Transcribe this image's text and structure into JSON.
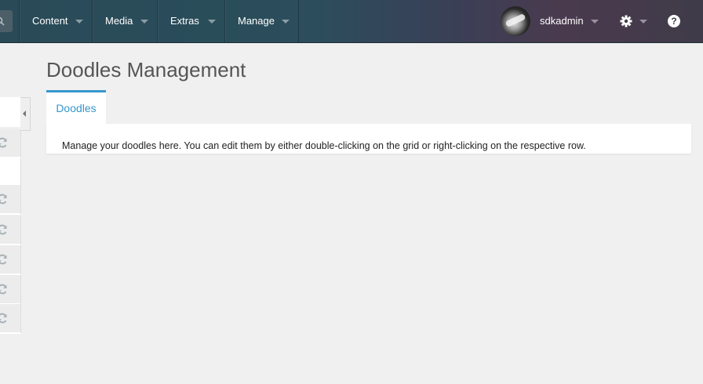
{
  "topbar": {
    "nav": [
      {
        "label": "Content"
      },
      {
        "label": "Media"
      },
      {
        "label": "Extras"
      },
      {
        "label": "Manage"
      }
    ],
    "user": {
      "name": "sdkadmin"
    },
    "help_glyph": "?",
    "icons": [
      "search-icon",
      "caret-down-icon",
      "gear-icon",
      "help-icon"
    ]
  },
  "page": {
    "title": "Doodles Management",
    "tabs": [
      {
        "label": "Doodles",
        "active": true
      }
    ],
    "description": "Manage your doodles here. You can edit them by either double-clicking on the grid or right-clicking on the respective row."
  },
  "left_panel": {
    "icons": [
      "refresh-icon"
    ]
  },
  "colors": {
    "accent": "#3697cd",
    "background": "#f0f0f0"
  }
}
